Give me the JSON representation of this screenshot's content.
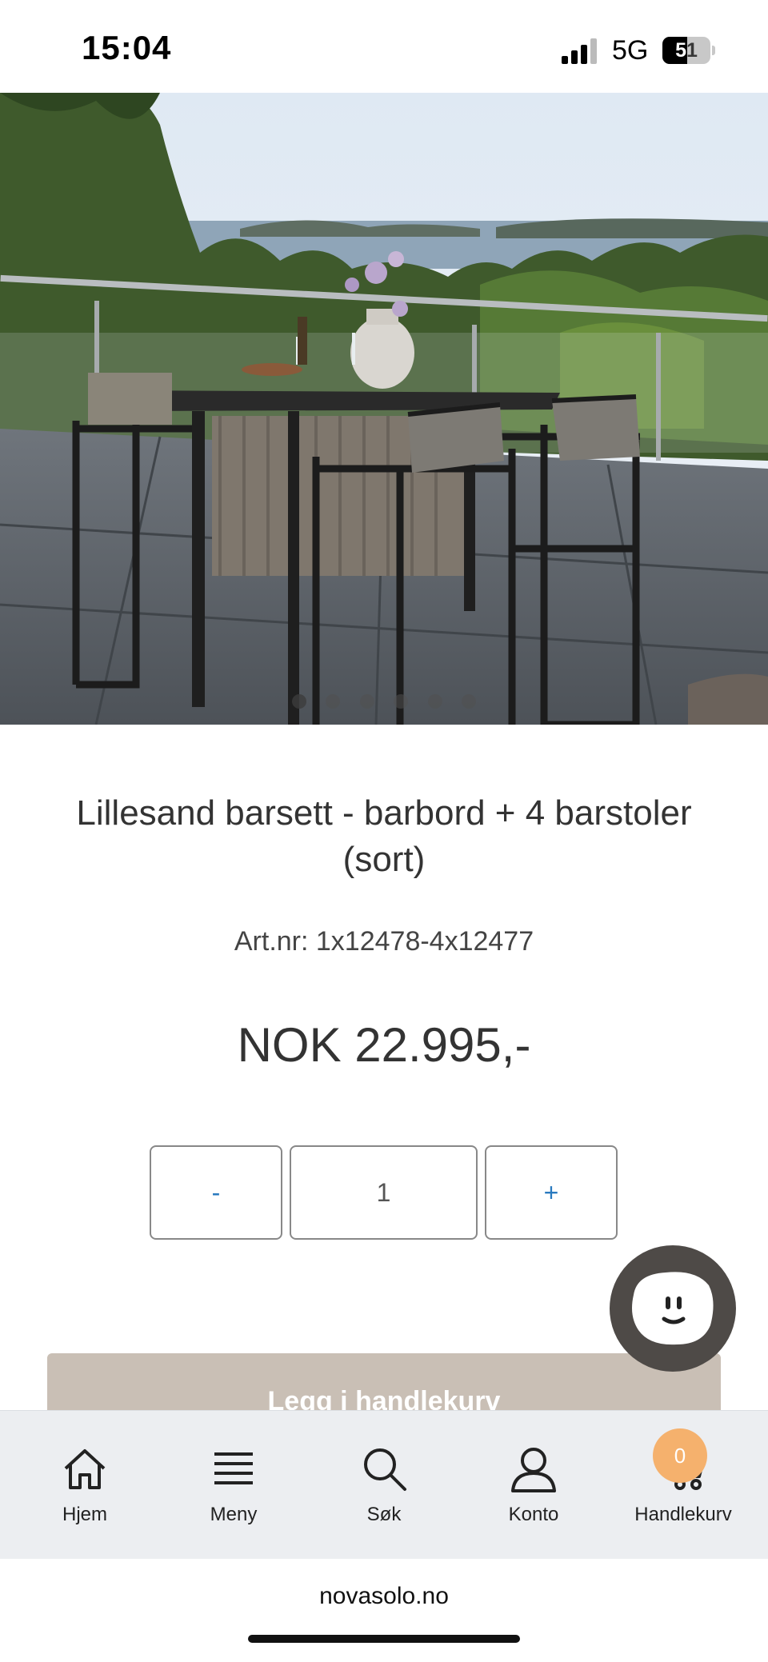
{
  "status_bar": {
    "time": "15:04",
    "network": "5G",
    "battery": "51"
  },
  "gallery": {
    "image_alt": "Lillesand barsett på terrasse",
    "dot_count": 6,
    "active_dot": 0
  },
  "product": {
    "title": "Lillesand barsett - barbord + 4 barstoler (sort)",
    "art_nr": "Art.nr: 1x12478-4x12477",
    "price": "NOK 22.995,-"
  },
  "quantity": {
    "minus": "-",
    "value": "1",
    "plus": "+"
  },
  "add_to_cart": {
    "label": "Legg i handlekurv"
  },
  "chat": {
    "icon": "chat-bubble-smile-icon"
  },
  "bottom_nav": {
    "items": [
      {
        "label": "Hjem",
        "icon": "home-icon"
      },
      {
        "label": "Meny",
        "icon": "menu-icon"
      },
      {
        "label": "Søk",
        "icon": "search-icon"
      },
      {
        "label": "Konto",
        "icon": "user-icon"
      },
      {
        "label": "Handlekurv",
        "icon": "cart-icon"
      }
    ],
    "cart_count": "0"
  },
  "browser": {
    "url": "novasolo.no"
  },
  "colors": {
    "accent_link": "#2a7abf",
    "cart_button": "#c9bfb5",
    "badge": "#f5b16d",
    "nav_bg": "#eceef1"
  }
}
